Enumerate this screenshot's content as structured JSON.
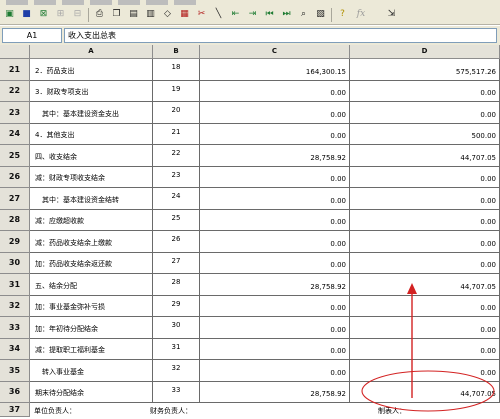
{
  "toolbar": {
    "buttons": [
      "new-sheet",
      "save",
      "close",
      "grid-1",
      "grid-2",
      "print",
      "copy",
      "paste",
      "paste-special",
      "clear",
      "insert-rows",
      "delete-rows",
      "line",
      "sort-asc",
      "sort-desc",
      "first",
      "last",
      "find",
      "grid-settings",
      "help",
      "formula",
      "exit"
    ]
  },
  "formula_bar": {
    "cell_ref": "A1",
    "value": "收入支出总表"
  },
  "columns": [
    "A",
    "B",
    "C",
    "D"
  ],
  "rows": [
    {
      "num": "21",
      "a": "2．药品支出",
      "b": "18",
      "c": "164,300.15",
      "d": "575,517.26"
    },
    {
      "num": "22",
      "a": "3．财政专项支出",
      "b": "19",
      "c": "0.00",
      "d": "0.00"
    },
    {
      "num": "23",
      "a": "　其中：基本建设资金支出",
      "b": "20",
      "c": "0.00",
      "d": "0.00"
    },
    {
      "num": "24",
      "a": "4．其他支出",
      "b": "21",
      "c": "0.00",
      "d": "500.00"
    },
    {
      "num": "25",
      "a": "四、收支结余",
      "b": "22",
      "c": "28,758.92",
      "d": "44,707.05"
    },
    {
      "num": "26",
      "a": "减：财政专项收支结余",
      "b": "23",
      "c": "0.00",
      "d": "0.00"
    },
    {
      "num": "27",
      "a": "　其中：基本建设资金结转",
      "b": "24",
      "c": "0.00",
      "d": "0.00"
    },
    {
      "num": "28",
      "a": "减：应缴超收款",
      "b": "25",
      "c": "0.00",
      "d": "0.00"
    },
    {
      "num": "29",
      "a": "减：药品收支结余上缴款",
      "b": "26",
      "c": "0.00",
      "d": "0.00"
    },
    {
      "num": "30",
      "a": "加：药品收支结余返还款",
      "b": "27",
      "c": "0.00",
      "d": "0.00"
    },
    {
      "num": "31",
      "a": "五、结余分配",
      "b": "28",
      "c": "28,758.92",
      "d": "44,707.05"
    },
    {
      "num": "32",
      "a": "加：事业基金弥补亏损",
      "b": "29",
      "c": "0.00",
      "d": "0.00"
    },
    {
      "num": "33",
      "a": "加：年初待分配结余",
      "b": "30",
      "c": "0.00",
      "d": "0.00"
    },
    {
      "num": "34",
      "a": "减：提取职工福利基金",
      "b": "31",
      "c": "0.00",
      "d": "0.00"
    },
    {
      "num": "35",
      "a": "　转入事业基金",
      "b": "32",
      "c": "0.00",
      "d": "0.00"
    },
    {
      "num": "36",
      "a": "期末待分配结余",
      "b": "33",
      "c": "28,758.92",
      "d": "44,707.05"
    }
  ],
  "footer": {
    "num": "37",
    "unit_head": "单位负责人：",
    "finance_head": "财务负责人：",
    "preparer": "制表人："
  },
  "annotation": {
    "color": "#d32222"
  }
}
